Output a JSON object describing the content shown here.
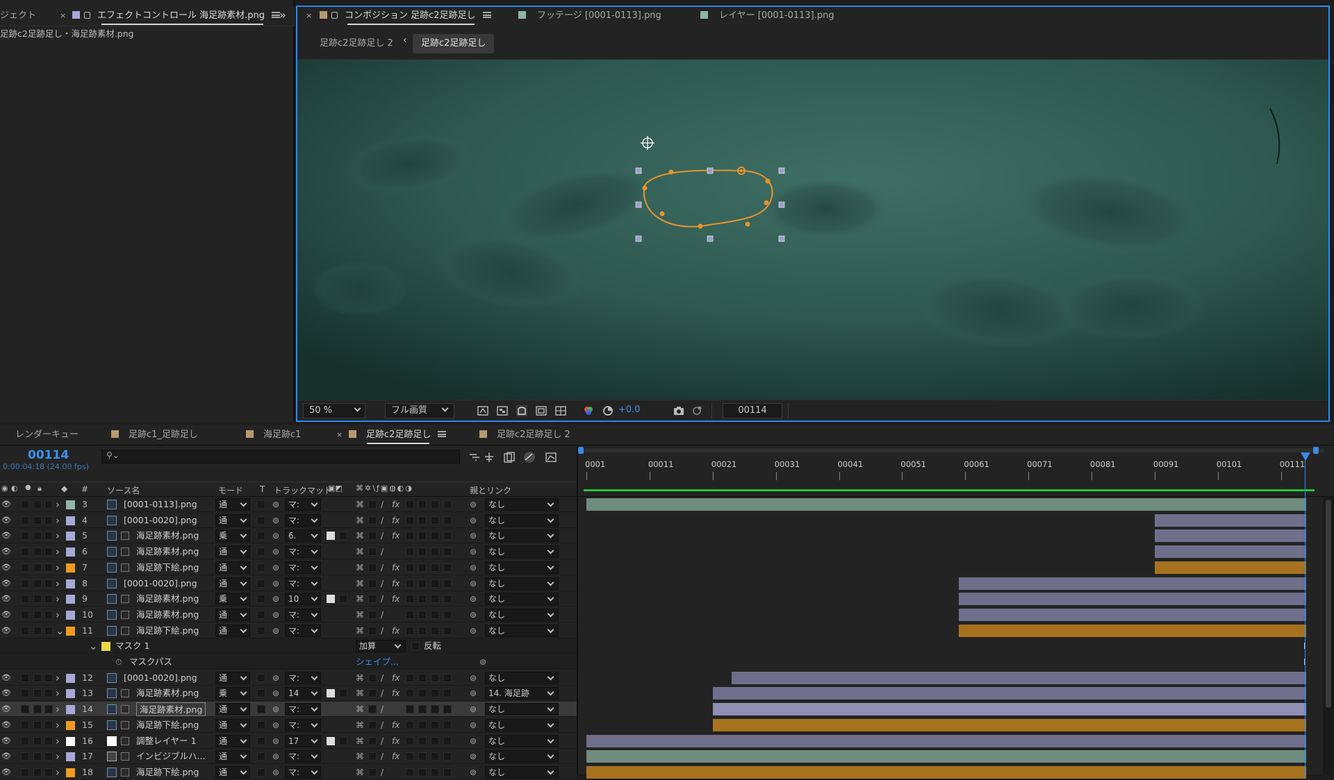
{
  "left_panel": {
    "tab_project": "ジェクト",
    "tab_effects": "エフェクトコントロール 海足跡素材.png",
    "subtitle": "足跡c2足跡足し・海足跡素材.png",
    "expand_glyph": "»"
  },
  "viewer": {
    "tabs": [
      {
        "label": "コンポジション 足跡c2足跡足し",
        "active": true
      },
      {
        "label": "フッテージ [0001-0113].png",
        "active": false
      },
      {
        "label": "レイヤー [0001-0113].png",
        "active": false
      }
    ],
    "crumbs": [
      "足跡c2足跡足し 2",
      "足跡c2足跡足し"
    ],
    "zoom": "50 %",
    "quality": "フル画質",
    "exposure": "+0.0",
    "timecode": "00114",
    "colors": {
      "mask_path": "#e8952b",
      "accent": "#2d8ceb"
    }
  },
  "timeline": {
    "tabs": [
      {
        "label": "レンダーキュー",
        "color": "",
        "active": false
      },
      {
        "label": "足跡c1_足跡足し",
        "color": "#b79a72",
        "active": false
      },
      {
        "label": "海足跡c1",
        "color": "#b79a72",
        "active": false
      },
      {
        "label": "足跡c2足跡足し",
        "color": "#b79a72",
        "active": true
      },
      {
        "label": "足跡c2足跡足し 2",
        "color": "#b79a72",
        "active": false
      }
    ],
    "current_frame": "00114",
    "current_time": "0:00:04:18 (24.00 fps)",
    "search_placeholder": "",
    "columns": {
      "num": "#",
      "source_name": "ソース名",
      "mode": "モード",
      "t": "T",
      "track_matte": "トラックマット",
      "parent_link": "親とリンク"
    },
    "ruler_ticks": [
      "0001",
      "00011",
      "00021",
      "00031",
      "00041",
      "00051",
      "00061",
      "00071",
      "00081",
      "00091",
      "00101",
      "00111"
    ],
    "layers": [
      {
        "num": "3",
        "label": "#8fb6a8",
        "icon": "comp",
        "name": "[0001-0113].png",
        "mode": "通",
        "matte": "マ:",
        "fx": true,
        "parent": "なし",
        "selected": false,
        "bar_start": 0,
        "bar_end": 114,
        "bar_color": "#6f8c80"
      },
      {
        "num": "4",
        "label": "#a9a8d6",
        "icon": "comp",
        "name": "[0001-0020].png",
        "mode": "通",
        "matte": "マ:",
        "fx": true,
        "parent": "なし",
        "selected": false,
        "bar_start": 90,
        "bar_end": 114,
        "bar_color": "#6f6f8c"
      },
      {
        "num": "5",
        "label": "#a9a8d6",
        "icon": "file",
        "name": "海足跡素材.png",
        "mode": "乗",
        "matte": "6.",
        "fx": true,
        "parent": "なし",
        "selected": false,
        "bar_start": 90,
        "bar_end": 114,
        "bar_color": "#6f6f8c"
      },
      {
        "num": "6",
        "label": "#a9a8d6",
        "icon": "file",
        "name": "海足跡素材.png",
        "mode": "通",
        "matte": "マ:",
        "fx": false,
        "parent": "なし",
        "selected": false,
        "bar_start": 90,
        "bar_end": 114,
        "bar_color": "#6f6f8c"
      },
      {
        "num": "7",
        "label": "#f09b1f",
        "icon": "file",
        "name": "海足跡下絵.png",
        "mode": "通",
        "matte": "マ:",
        "fx": true,
        "parent": "なし",
        "selected": false,
        "bar_start": 90,
        "bar_end": 114,
        "bar_color": "#a77220"
      },
      {
        "num": "8",
        "label": "#a9a8d6",
        "icon": "comp",
        "name": "[0001-0020].png",
        "mode": "通",
        "matte": "マ:",
        "fx": true,
        "parent": "なし",
        "selected": false,
        "bar_start": 59,
        "bar_end": 114,
        "bar_color": "#6f6f8c"
      },
      {
        "num": "9",
        "label": "#a9a8d6",
        "icon": "file",
        "name": "海足跡素材.png",
        "mode": "乗",
        "matte": "10",
        "fx": true,
        "parent": "なし",
        "selected": false,
        "bar_start": 59,
        "bar_end": 114,
        "bar_color": "#6f6f8c"
      },
      {
        "num": "10",
        "label": "#a9a8d6",
        "icon": "file",
        "name": "海足跡素材.png",
        "mode": "通",
        "matte": "マ:",
        "fx": false,
        "parent": "なし",
        "selected": false,
        "bar_start": 59,
        "bar_end": 114,
        "bar_color": "#6f6f8c"
      },
      {
        "num": "11",
        "label": "#f09b1f",
        "icon": "file",
        "name": "海足跡下絵.png",
        "mode": "通",
        "matte": "マ:",
        "fx": true,
        "parent": "なし",
        "selected": false,
        "bar_start": 59,
        "bar_end": 114,
        "bar_color": "#a77220",
        "expanded": true
      },
      {
        "num": "12",
        "label": "#a9a8d6",
        "icon": "comp",
        "name": "[0001-0020].png",
        "mode": "通",
        "matte": "マ:",
        "fx": true,
        "parent": "なし",
        "selected": false,
        "bar_start": 23,
        "bar_end": 114,
        "bar_color": "#6f6f8c"
      },
      {
        "num": "13",
        "label": "#a9a8d6",
        "icon": "file",
        "name": "海足跡素材.png",
        "mode": "乗",
        "matte": "14",
        "fx": true,
        "parent": "14. 海足跡",
        "selected": false,
        "bar_start": 20,
        "bar_end": 114,
        "bar_color": "#6f6f8c"
      },
      {
        "num": "14",
        "label": "#a9a8d6",
        "icon": "file",
        "name": "海足跡素材.png",
        "mode": "通",
        "matte": "マ:",
        "fx": false,
        "parent": "なし",
        "selected": true,
        "bar_start": 20,
        "bar_end": 114,
        "bar_color": "#8f8fb4"
      },
      {
        "num": "15",
        "label": "#f09b1f",
        "icon": "file",
        "name": "海足跡下絵.png",
        "mode": "通",
        "matte": "マ:",
        "fx": true,
        "parent": "なし",
        "selected": false,
        "bar_start": 20,
        "bar_end": 114,
        "bar_color": "#a77220"
      },
      {
        "num": "16",
        "label": "#ffffff",
        "icon": "adj",
        "name": "調整レイヤー 1",
        "mode": "通",
        "matte": "17",
        "fx": true,
        "parent": "なし",
        "selected": false,
        "bar_start": 0,
        "bar_end": 114,
        "bar_color": "#6f6f8c"
      },
      {
        "num": "17",
        "label": "#a9a8d6",
        "icon": "film",
        "name": "インビジブルハ...",
        "mode": "通",
        "matte": "マ:",
        "fx": true,
        "parent": "なし",
        "selected": false,
        "bar_start": 0,
        "bar_end": 114,
        "bar_color": "#6f8c80"
      },
      {
        "num": "18",
        "label": "#f09b1f",
        "icon": "file",
        "name": "海足跡下絵.png",
        "mode": "通",
        "matte": "マ:",
        "fx": false,
        "parent": "なし",
        "selected": false,
        "bar_start": 0,
        "bar_end": 114,
        "bar_color": "#a77220"
      }
    ],
    "mask": {
      "name": "マスク 1",
      "mode": "加算",
      "invert": "反転",
      "path_label": "マスクパス",
      "path_value": "シェイプ..."
    }
  }
}
